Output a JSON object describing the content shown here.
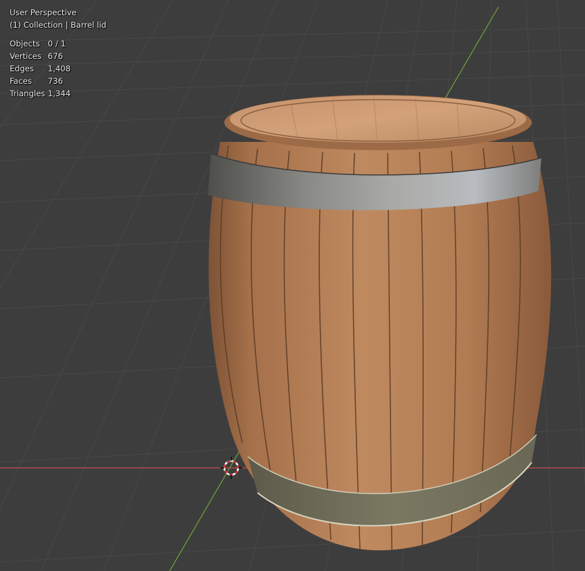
{
  "viewport": {
    "view_name": "User Perspective",
    "collection_info": "(1) Collection | Barrel lid"
  },
  "stats": [
    {
      "label": "Objects",
      "value": "0 / 1"
    },
    {
      "label": "Vertices",
      "value": "676"
    },
    {
      "label": "Edges",
      "value": "1,408"
    },
    {
      "label": "Faces",
      "value": "736"
    },
    {
      "label": "Triangles",
      "value": "1,344"
    }
  ],
  "colors": {
    "background": "#3d3d3d",
    "grid": "#4a4a4a",
    "x_axis": "#c84b4b",
    "y_axis": "#6fa53a",
    "wood": "#b07a52",
    "metal_band": "#6e6e6e"
  },
  "icons": {
    "cursor": "3d-cursor-icon"
  }
}
